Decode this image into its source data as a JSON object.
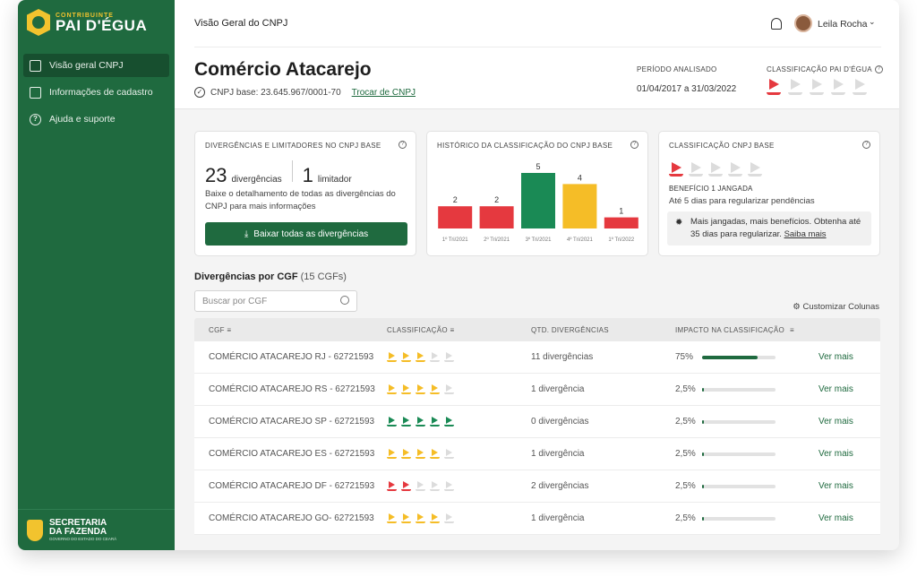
{
  "brand": {
    "small": "CONTRIBUINTE",
    "large": "PAI D'ÉGUA"
  },
  "sidebar": {
    "items": [
      {
        "label": "Visão geral CNPJ",
        "active": true
      },
      {
        "label": "Informações de cadastro"
      },
      {
        "label": "Ajuda e suporte"
      }
    ],
    "footer": {
      "line1": "SECRETARIA",
      "line2": "DA FAZENDA",
      "line3": "GOVERNO DO ESTADO DO CEARÁ"
    }
  },
  "header": {
    "breadcrumb": "Visão Geral do CNPJ",
    "user": "Leila Rocha"
  },
  "company": {
    "name": "Comércio Atacarejo",
    "cnpj_label": "CNPJ base: 23.645.967/0001-70",
    "change_link": "Trocar de CNPJ"
  },
  "period": {
    "label": "PERÍODO ANALISADO",
    "value": "01/04/2017 a 31/03/2022"
  },
  "rating": {
    "label": "CLASSIFICAÇÃO PAI D'ÉGUA",
    "level": 1,
    "max": 5,
    "color": "#e5393f"
  },
  "card_divergences": {
    "title": "DIVERGÊNCIAS E LIMITADORES NO CNPJ BASE",
    "count": "23",
    "count_label": "divergências",
    "limit": "1",
    "limit_label": "limitador",
    "description": "Baixe o detalhamento de todas as divergências do CNPJ para mais informações",
    "button": "Baixar todas as divergências"
  },
  "card_history": {
    "title": "HISTÓRICO DA CLASSIFICAÇÃO DO CNPJ BASE"
  },
  "chart_data": {
    "type": "bar",
    "categories": [
      "1º Tri/2021",
      "2º Tri/2021",
      "3º Tri/2021",
      "4º Tri/2021",
      "1º Tri/2022"
    ],
    "values": [
      2,
      2,
      5,
      4,
      1
    ],
    "colors": [
      "#e5393f",
      "#e5393f",
      "#1a8a55",
      "#f5bd27",
      "#e5393f"
    ],
    "ylim": [
      0,
      5
    ]
  },
  "card_class": {
    "title": "CLASSIFICAÇÃO CNPJ BASE",
    "benefit": "BENEFÍCIO 1 JANGADA",
    "days": "Até 5 dias para regularizar pendências",
    "tip": "Mais jangadas, mais benefícios. Obtenha até 35 dias para regularizar.",
    "tip_link": "Saiba mais"
  },
  "list": {
    "title": "Divergências por CGF",
    "count": "(15 CGFs)",
    "search_placeholder": "Buscar por CGF",
    "customize": "Customizar Colunas",
    "headers": [
      "CGF",
      "CLASSIFICAÇÃO",
      "QTD. DIVERGÊNCIAS",
      "IMPACTO NA CLASSIFICAÇÃO"
    ],
    "rows": [
      {
        "cgf": "COMÉRCIO ATACAREJO RJ - 62721593",
        "level": 3,
        "color": "#f5bd27",
        "div": "11 divergências",
        "impact": "75%",
        "fill": 0.75,
        "action": "Ver mais"
      },
      {
        "cgf": "COMÉRCIO ATACAREJO RS - 62721593",
        "level": 4,
        "color": "#f5bd27",
        "div": "1 divergência",
        "impact": "2,5%",
        "fill": 0.025,
        "action": "Ver mais"
      },
      {
        "cgf": "COMÉRCIO ATACAREJO SP - 62721593",
        "level": 5,
        "color": "#1a8a55",
        "div": "0 divergências",
        "impact": "2,5%",
        "fill": 0.025,
        "action": "Ver mais"
      },
      {
        "cgf": "COMÉRCIO ATACAREJO ES - 62721593",
        "level": 4,
        "color": "#f5bd27",
        "div": "1 divergência",
        "impact": "2,5%",
        "fill": 0.025,
        "action": "Ver mais"
      },
      {
        "cgf": "COMÉRCIO ATACAREJO DF - 62721593",
        "level": 2,
        "color": "#e5393f",
        "div": "2 divergências",
        "impact": "2,5%",
        "fill": 0.025,
        "action": "Ver mais"
      },
      {
        "cgf": "COMÉRCIO ATACAREJO GO- 62721593",
        "level": 4,
        "color": "#f5bd27",
        "div": "1 divergência",
        "impact": "2,5%",
        "fill": 0.025,
        "action": "Ver mais"
      }
    ]
  }
}
